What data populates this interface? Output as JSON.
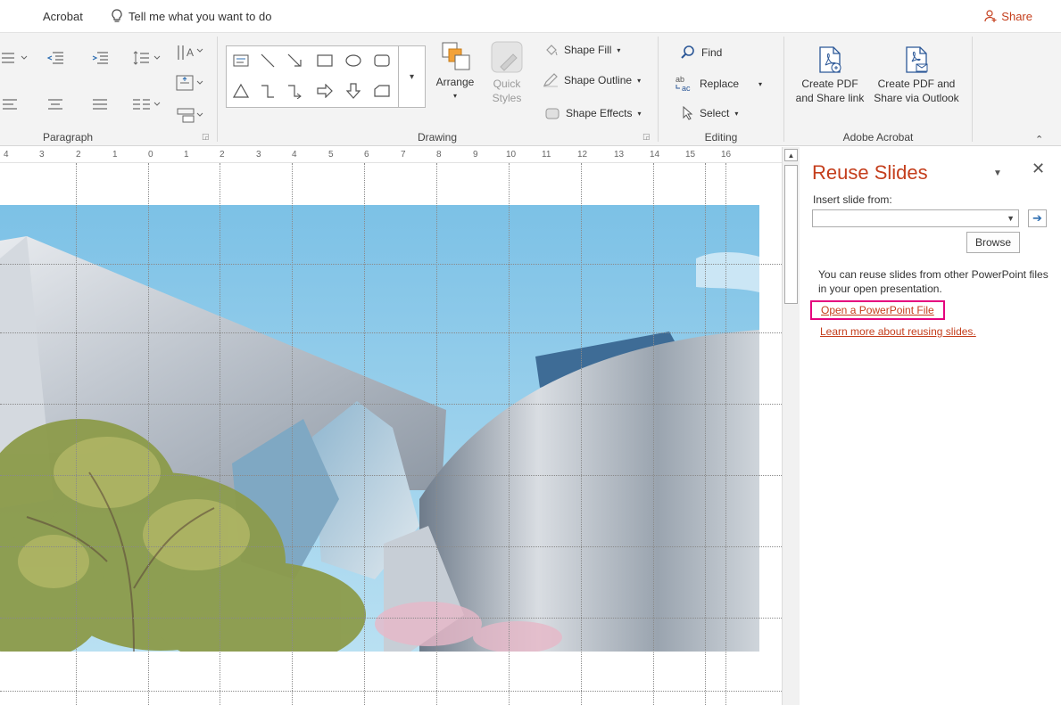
{
  "titlebar": {
    "acrobat_tab": "Acrobat",
    "tell_me": "Tell me what you want to do",
    "share": "Share"
  },
  "ribbon": {
    "groups": {
      "paragraph": "Paragraph",
      "drawing": "Drawing",
      "editing": "Editing",
      "adobe_acrobat": "Adobe Acrobat"
    },
    "arrange": "Arrange",
    "quick_styles_1": "Quick",
    "quick_styles_2": "Styles",
    "shape_fill": "Shape Fill",
    "shape_outline": "Shape Outline",
    "shape_effects": "Shape Effects",
    "find": "Find",
    "replace": "Replace",
    "select": "Select",
    "create_pdf_share_link_1": "Create PDF",
    "create_pdf_share_link_2": "and Share link",
    "create_pdf_outlook_1": "Create PDF and",
    "create_pdf_outlook_2": "Share via Outlook"
  },
  "ruler": {
    "labels": [
      "4",
      "3",
      "2",
      "1",
      "0",
      "1",
      "2",
      "3",
      "4",
      "5",
      "6",
      "7",
      "8",
      "9",
      "10",
      "11",
      "12",
      "13",
      "14",
      "15",
      "16"
    ]
  },
  "pane": {
    "title": "Reuse Slides",
    "insert_from_label": "Insert slide from:",
    "source_value": "",
    "browse": "Browse",
    "info": "You can reuse slides from other PowerPoint files in your open presentation.",
    "open_link": "Open a PowerPoint File",
    "learn_link": "Learn more about reusing slides."
  },
  "colors": {
    "accent": "#c43e1c",
    "highlight_box": "#e5007e",
    "ribbon_bg": "#f3f3f3"
  }
}
